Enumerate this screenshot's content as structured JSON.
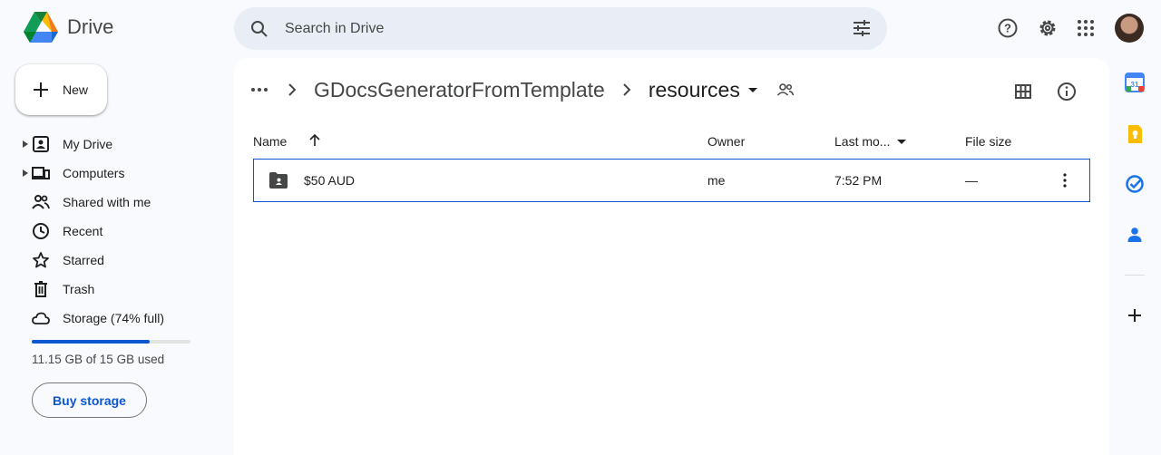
{
  "app": {
    "name": "Drive"
  },
  "search": {
    "placeholder": "Search in Drive"
  },
  "new_button": {
    "label": "New"
  },
  "sidebar": {
    "items": [
      {
        "label": "My Drive",
        "icon": "my-drive-icon"
      },
      {
        "label": "Computers",
        "icon": "computers-icon"
      },
      {
        "label": "Shared with me",
        "icon": "shared-icon"
      },
      {
        "label": "Recent",
        "icon": "clock-icon"
      },
      {
        "label": "Starred",
        "icon": "star-icon"
      },
      {
        "label": "Trash",
        "icon": "trash-icon"
      },
      {
        "label": "Storage (74% full)",
        "icon": "cloud-icon"
      }
    ]
  },
  "storage": {
    "used_fraction": 0.74,
    "text": "11.15 GB of 15 GB used",
    "buy_label": "Buy storage"
  },
  "breadcrumb": {
    "parent": "GDocsGeneratorFromTemplate",
    "current": "resources"
  },
  "table": {
    "headers": {
      "name": "Name",
      "owner": "Owner",
      "modified": "Last mo...",
      "size": "File size"
    },
    "rows": [
      {
        "name": "$50 AUD",
        "owner": "me",
        "modified": "7:52 PM",
        "size": "—"
      }
    ]
  },
  "colors": {
    "accent": "#0b57d0",
    "background": "#f8fafd",
    "search_bg": "#e9eef6"
  }
}
